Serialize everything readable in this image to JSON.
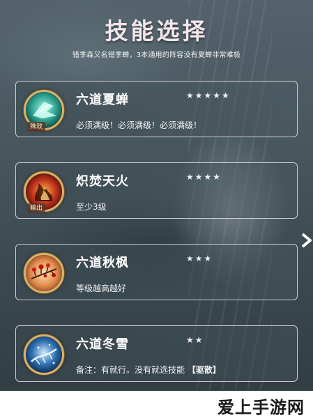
{
  "header": {
    "title": "技能选择",
    "subtitle": "错季森又名错季蝉，3本通用的阵容没有夏蝉非常难极"
  },
  "skills": [
    {
      "name": "六道夏蝉",
      "stars": "★★★★★",
      "tag": "殊效",
      "desc": "必须满级！必须满级！必须满级！",
      "desc_bold": "",
      "icon": "summer-cicada-icon"
    },
    {
      "name": "炽焚天火",
      "stars": "★★★★",
      "tag": "输出",
      "desc": "至少3级",
      "desc_bold": "",
      "icon": "blazing-fire-icon"
    },
    {
      "name": "六道秋枫",
      "stars": "★★★",
      "tag": "",
      "desc": "等级越高越好",
      "desc_bold": "",
      "icon": "autumn-maple-icon"
    },
    {
      "name": "六道冬雪",
      "stars": "★★",
      "tag": "",
      "desc": "备注：有就行。没有就选技能",
      "desc_bold": "【驱散】",
      "icon": "winter-snow-icon"
    }
  ],
  "watermark": "爱上手游网",
  "colors": {
    "accent_gold": "#d9b26a",
    "card_border": "#ebe1e6",
    "title": "#f3e6ea"
  }
}
